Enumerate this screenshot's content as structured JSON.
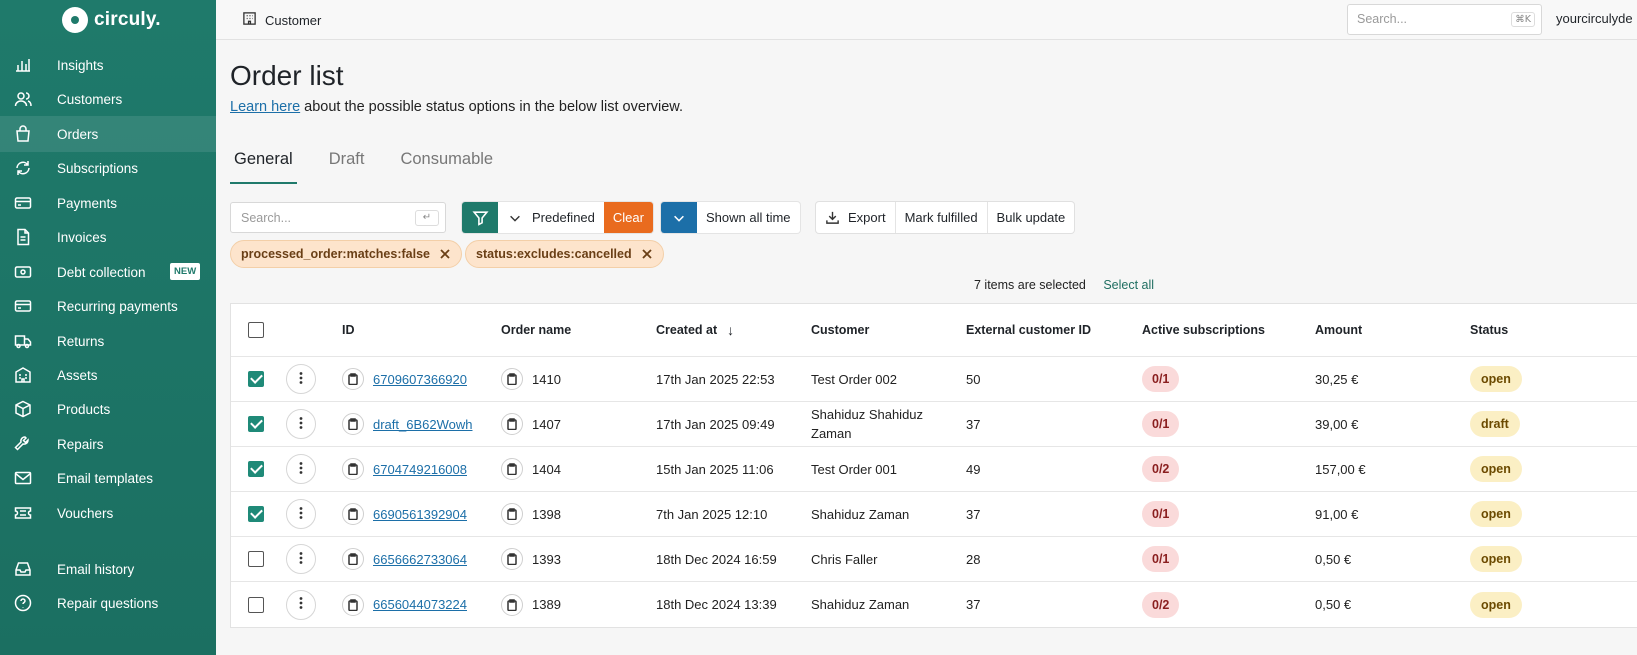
{
  "brand": {
    "name": "circuly.",
    "accent": "#1f7a6b",
    "orange": "#e96b1e",
    "blue": "#1c6fa8"
  },
  "sidebar": {
    "items": [
      {
        "label": "Insights",
        "icon": "chart-icon"
      },
      {
        "label": "Customers",
        "icon": "users-icon"
      },
      {
        "label": "Orders",
        "icon": "bag-icon",
        "active": true
      },
      {
        "label": "Subscriptions",
        "icon": "refresh-icon"
      },
      {
        "label": "Payments",
        "icon": "card-icon"
      },
      {
        "label": "Invoices",
        "icon": "document-icon"
      },
      {
        "label": "Debt collection",
        "icon": "money-icon",
        "badge": "NEW"
      },
      {
        "label": "Recurring payments",
        "icon": "card-icon"
      },
      {
        "label": "Returns",
        "icon": "truck-icon"
      },
      {
        "label": "Assets",
        "icon": "building-icon"
      },
      {
        "label": "Products",
        "icon": "box-icon"
      },
      {
        "label": "Repairs",
        "icon": "wrench-icon"
      },
      {
        "label": "Email templates",
        "icon": "mail-icon"
      },
      {
        "label": "Vouchers",
        "icon": "ticket-icon"
      },
      {
        "label": "Email history",
        "icon": "inbox-icon"
      },
      {
        "label": "Repair questions",
        "icon": "question-icon"
      }
    ]
  },
  "topbar": {
    "breadcrumb": "Customer",
    "search_placeholder": "Search...",
    "shortcut": "⌘K",
    "user": "yourcirculyde"
  },
  "page": {
    "title": "Order list",
    "learn_link": "Learn here",
    "subtitle_rest": " about the possible status options in the below list overview."
  },
  "tabs": [
    "General",
    "Draft",
    "Consumable"
  ],
  "toolbar": {
    "search_placeholder": "Search...",
    "enter_key": "↵",
    "predefined": "Predefined",
    "clear": "Clear",
    "time_range": "Shown all time",
    "export": "Export",
    "mark_fulfilled": "Mark fulfilled",
    "bulk_update": "Bulk update"
  },
  "filters": [
    "processed_order:matches:false",
    "status:excludes:cancelled"
  ],
  "selection": {
    "text": "7 items are selected",
    "select_all": "Select all"
  },
  "table": {
    "columns": [
      "ID",
      "Order name",
      "Created at",
      "Customer",
      "External customer ID",
      "Active subscriptions",
      "Amount",
      "Status"
    ],
    "sort_arrow": "↓",
    "rows": [
      {
        "checked": true,
        "id": "6709607366920",
        "order_name": "1410",
        "created_at": "17th Jan 2025 22:53",
        "customer": "Test Order 002",
        "external_id": "50",
        "active_subs": "0/1",
        "amount": "30,25 €",
        "status": "open"
      },
      {
        "checked": true,
        "id": "draft_6B62Wowh",
        "order_name": "1407",
        "created_at": "17th Jan 2025 09:49",
        "customer": "Shahiduz Shahiduz Zaman",
        "external_id": "37",
        "active_subs": "0/1",
        "amount": "39,00 €",
        "status": "draft"
      },
      {
        "checked": true,
        "id": "6704749216008",
        "order_name": "1404",
        "created_at": "15th Jan 2025 11:06",
        "customer": "Test Order 001",
        "external_id": "49",
        "active_subs": "0/2",
        "amount": "157,00 €",
        "status": "open"
      },
      {
        "checked": true,
        "id": "6690561392904",
        "order_name": "1398",
        "created_at": "7th Jan 2025 12:10",
        "customer": "Shahiduz Zaman",
        "external_id": "37",
        "active_subs": "0/1",
        "amount": "91,00 €",
        "status": "open"
      },
      {
        "checked": false,
        "id": "6656662733064",
        "order_name": "1393",
        "created_at": "18th Dec 2024 16:59",
        "customer": "Chris Faller",
        "external_id": "28",
        "active_subs": "0/1",
        "amount": "0,50 €",
        "status": "open"
      },
      {
        "checked": false,
        "id": "6656044073224",
        "order_name": "1389",
        "created_at": "18th Dec 2024 13:39",
        "customer": "Shahiduz Zaman",
        "external_id": "37",
        "active_subs": "0/2",
        "amount": "0,50 €",
        "status": "open"
      }
    ]
  }
}
